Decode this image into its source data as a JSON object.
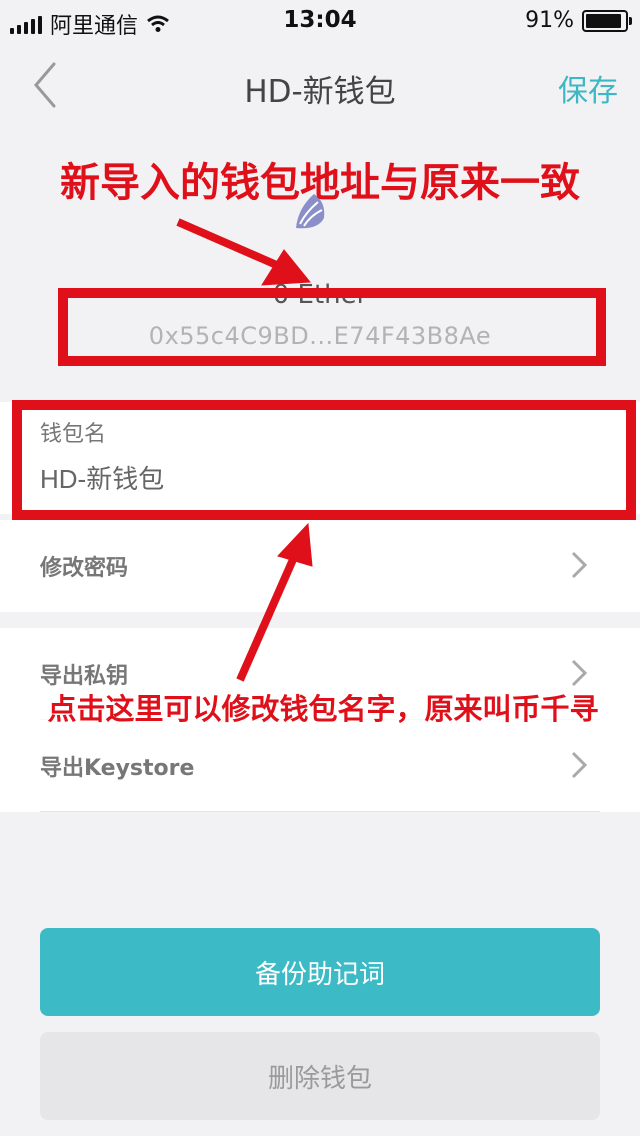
{
  "status_bar": {
    "carrier": "阿里通信",
    "time": "13:04",
    "battery_percent": "91%",
    "battery_level": 0.91
  },
  "nav": {
    "title": "HD-新钱包",
    "save_label": "保存",
    "back_icon": "chevron-left-icon"
  },
  "wallet": {
    "balance": "0 Ether",
    "address": "0x55c4C9BD...E74F43B8Ae",
    "logo_icon": "shell-icon"
  },
  "name_field": {
    "label": "钱包名",
    "value": "HD-新钱包"
  },
  "menu": {
    "change_password": "修改密码",
    "export_private_key": "导出私钥",
    "export_keystore": "导出Keystore"
  },
  "buttons": {
    "backup": "备份助记词",
    "delete": "删除钱包"
  },
  "annotations": {
    "top": "新导入的钱包地址与原来一致",
    "bottom": "点击这里可以修改钱包名字，原来叫币千寻"
  },
  "colors": {
    "accent": "#3cbac5",
    "annotation_red": "#e0101a"
  }
}
